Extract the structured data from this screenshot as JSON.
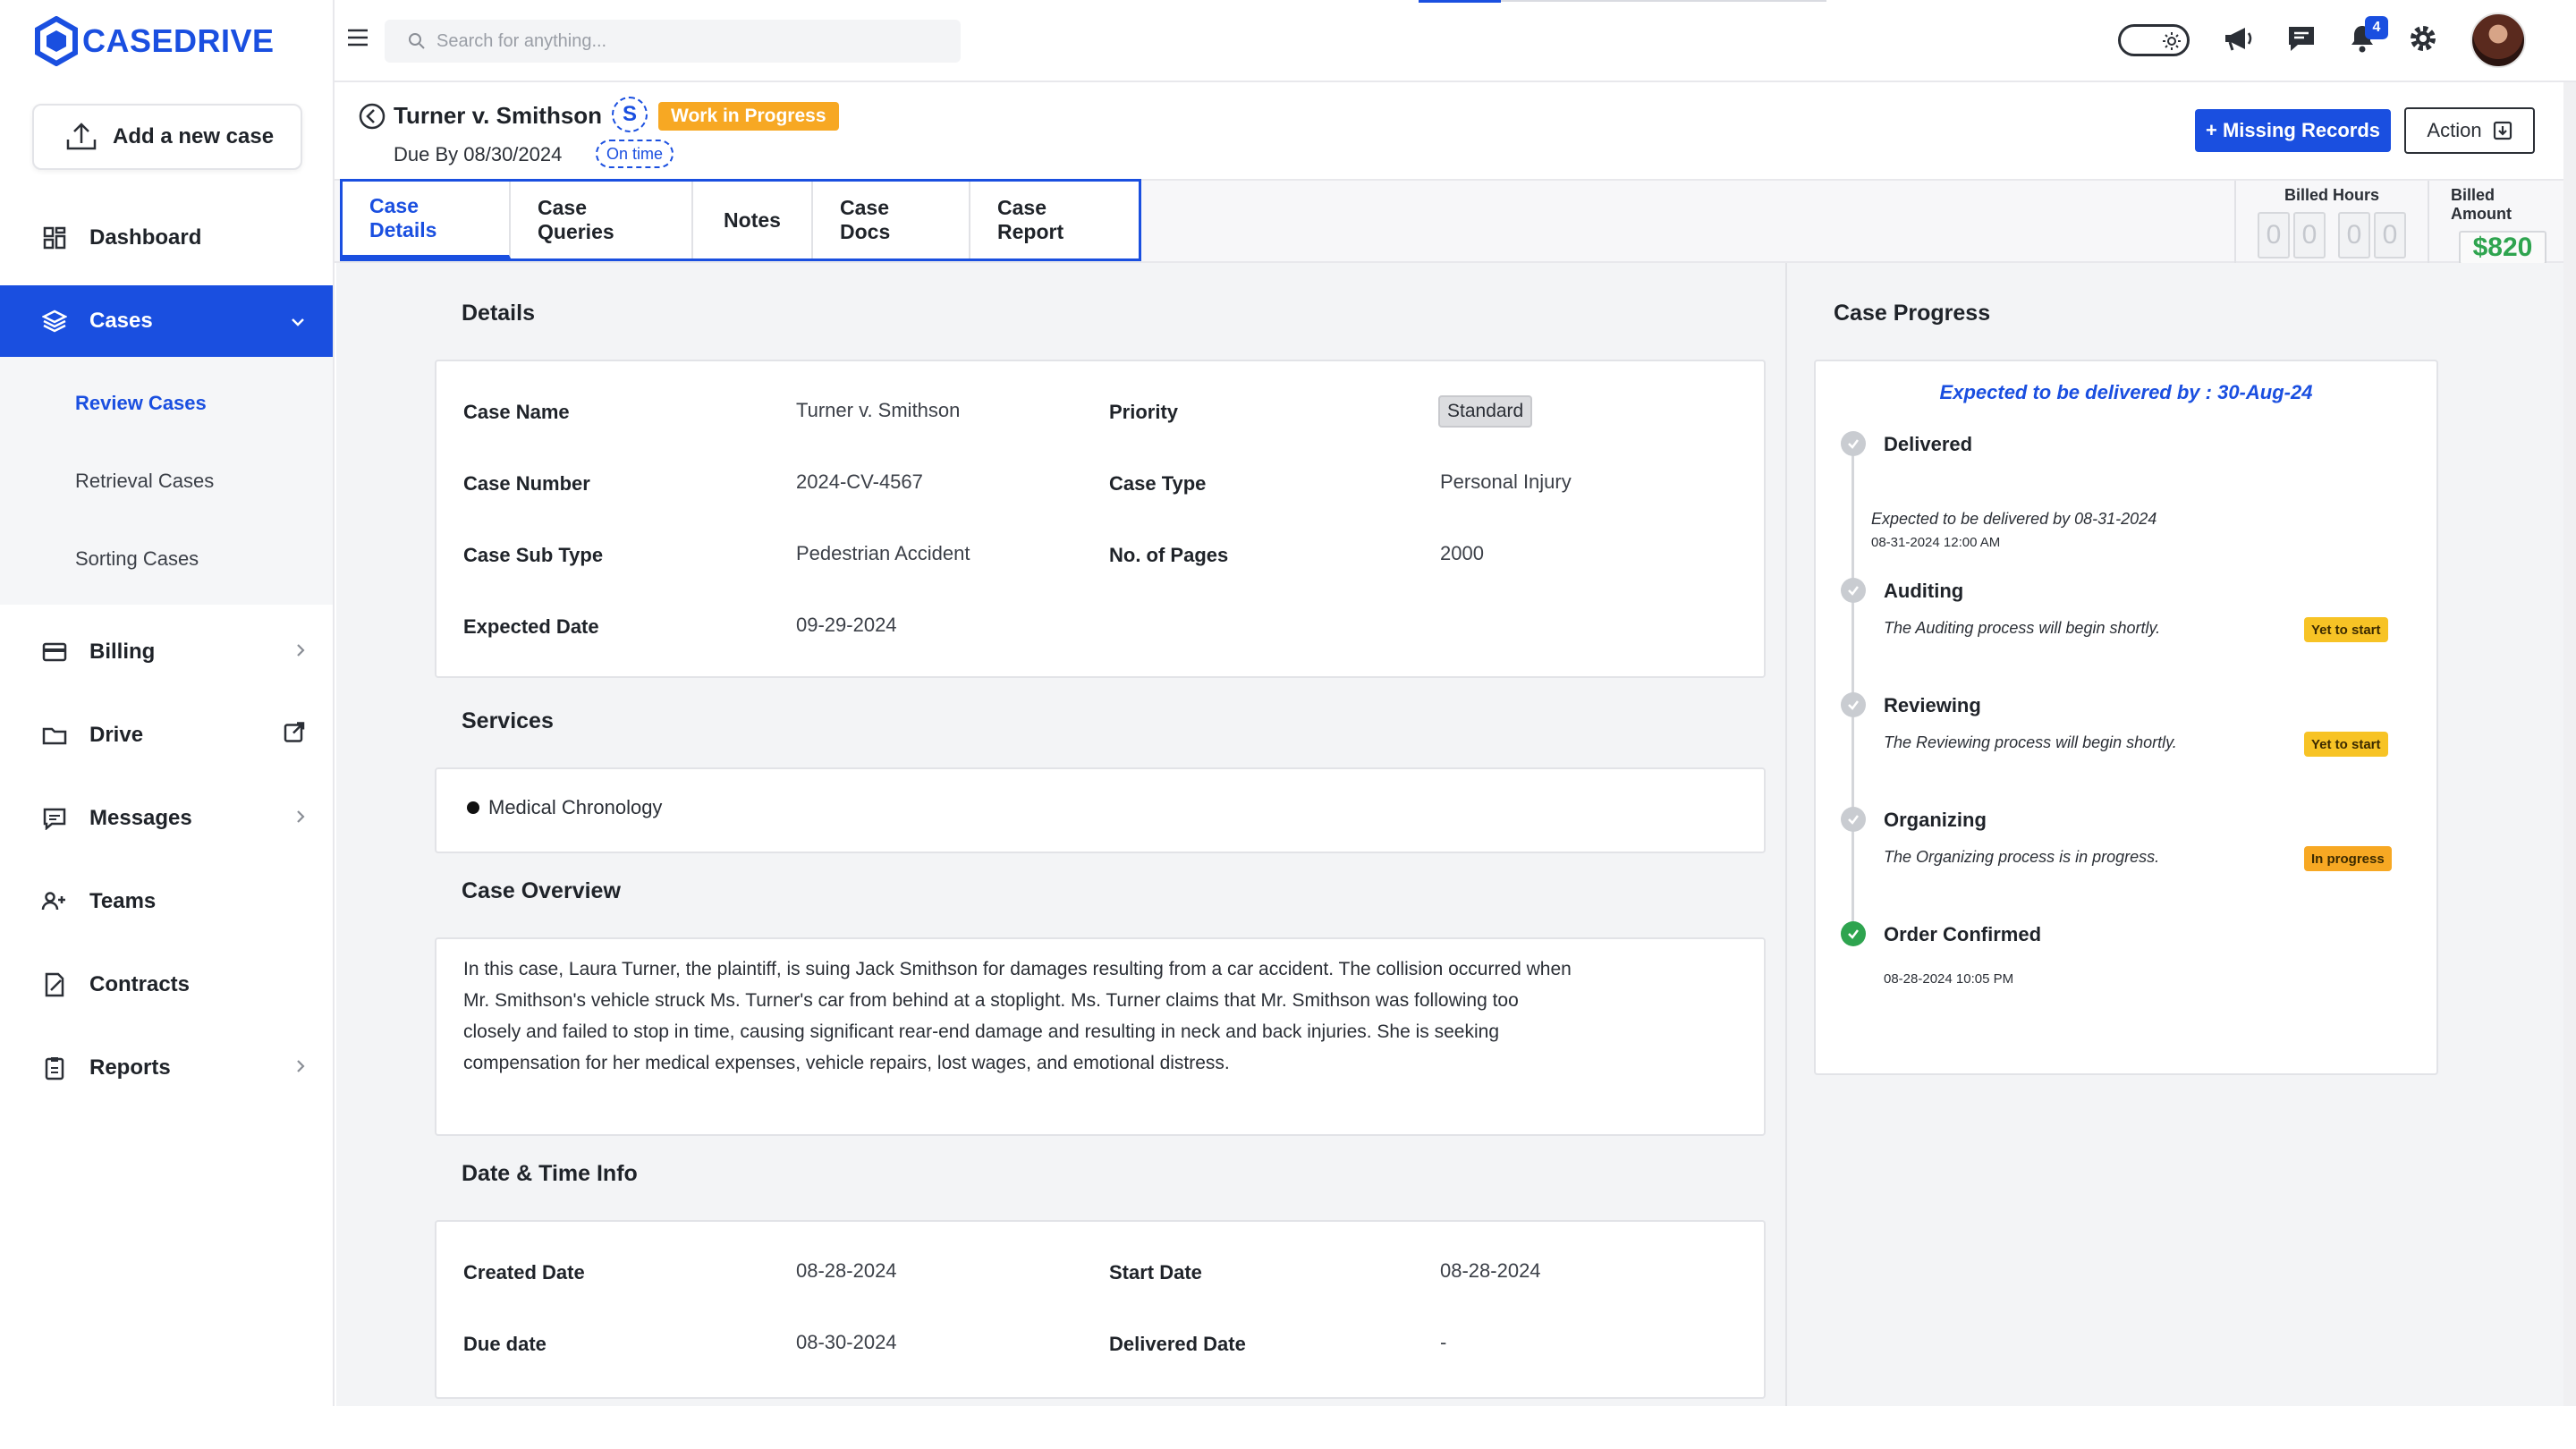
{
  "brand": {
    "name": "CASEDRIVE"
  },
  "sidebar": {
    "add_case_label": "Add a new case",
    "items": [
      {
        "label": "Dashboard",
        "icon": "dashboard-icon"
      },
      {
        "label": "Cases",
        "icon": "layers-icon",
        "active": true
      },
      {
        "label": "Billing",
        "icon": "card-icon"
      },
      {
        "label": "Drive",
        "icon": "folder-icon"
      },
      {
        "label": "Messages",
        "icon": "message-icon"
      },
      {
        "label": "Teams",
        "icon": "team-icon"
      },
      {
        "label": "Contracts",
        "icon": "contract-icon"
      },
      {
        "label": "Reports",
        "icon": "report-icon"
      }
    ],
    "cases_sub": [
      "Review Cases",
      "Retrieval Cases",
      "Sorting Cases"
    ]
  },
  "topbar": {
    "search_placeholder": "Search for anything...",
    "notification_count": "4"
  },
  "case": {
    "title": "Turner v. Smithson",
    "initial": "S",
    "status": "Work in Progress",
    "due_by": "Due By 08/30/2024",
    "timeliness": "On time",
    "missing_records_label": "+ Missing Records",
    "action_label": "Action"
  },
  "tabs": [
    "Case Details",
    "Case Queries",
    "Notes",
    "Case Docs",
    "Case Report"
  ],
  "billing": {
    "hours_label": "Billed Hours",
    "hours_digits": [
      "0",
      "0",
      "0",
      "0"
    ],
    "amount_label": "Billed Amount",
    "amount": "$820"
  },
  "details": {
    "title": "Details",
    "case_name_label": "Case Name",
    "case_name": "Turner  v. Smithson",
    "priority_label": "Priority",
    "priority": "Standard",
    "case_number_label": "Case Number",
    "case_number": "2024-CV-4567",
    "case_type_label": "Case Type",
    "case_type": "Personal Injury",
    "case_sub_type_label": "Case Sub Type",
    "case_sub_type": "Pedestrian Accident",
    "pages_label": "No. of Pages",
    "pages": "2000",
    "expected_date_label": "Expected Date",
    "expected_date": "09-29-2024"
  },
  "services": {
    "title": "Services",
    "items": [
      "Medical Chronology"
    ]
  },
  "overview": {
    "title": "Case Overview",
    "lines": [
      "In this case, Laura Turner, the plaintiff, is suing Jack Smithson for damages resulting from a car accident. The collision occurred when",
      "Mr. Smithson's vehicle struck Ms. Turner's car from behind at a stoplight. Ms. Turner claims that Mr. Smithson was following too",
      "closely and failed to stop in time, causing significant rear-end damage and resulting in neck and back injuries. She is seeking",
      "compensation for her medical expenses, vehicle repairs, lost wages, and emotional distress."
    ]
  },
  "datetime": {
    "title": "Date & Time Info",
    "created_label": "Created Date",
    "created": "08-28-2024",
    "start_label": "Start Date",
    "start": "08-28-2024",
    "due_label": "Due date",
    "due": "08-30-2024",
    "delivered_label": "Delivered Date",
    "delivered": "-"
  },
  "progress": {
    "title": "Case Progress",
    "expected": "Expected to be delivered by : 30-Aug-24",
    "steps": [
      {
        "title": "Delivered",
        "desc": "Expected to be delivered by 08-31-2024",
        "time": "08-31-2024 12:00 AM",
        "status": ""
      },
      {
        "title": "Auditing",
        "desc": "The Auditing process will begin shortly.",
        "status": "Yet to start"
      },
      {
        "title": "Reviewing",
        "desc": "The Reviewing process will begin shortly.",
        "status": "Yet to start"
      },
      {
        "title": "Organizing",
        "desc": "The Organizing process is in progress.",
        "status": "In progress"
      },
      {
        "title": "Order Confirmed",
        "time": "08-28-2024 10:05 PM",
        "status": "done"
      }
    ]
  }
}
